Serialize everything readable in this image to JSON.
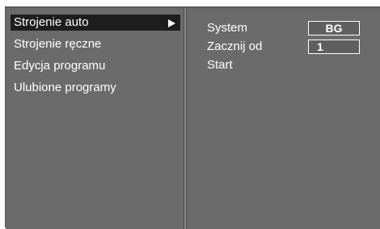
{
  "menu": {
    "items": [
      {
        "label": "Strojenie auto",
        "selected": true
      },
      {
        "label": "Strojenie ręczne",
        "selected": false
      },
      {
        "label": "Edycja programu",
        "selected": false
      },
      {
        "label": "Ulubione programy",
        "selected": false
      }
    ],
    "arrow_icon": "arrow-right-icon"
  },
  "settings": {
    "system_label": "System",
    "system_value": "BG",
    "start_from_label": "Zacznij  od",
    "start_from_value": "1",
    "start_label": "Start"
  },
  "colors": {
    "background": "#6b6b6b",
    "selected": "#1e1e1e",
    "text": "#ffffff"
  }
}
